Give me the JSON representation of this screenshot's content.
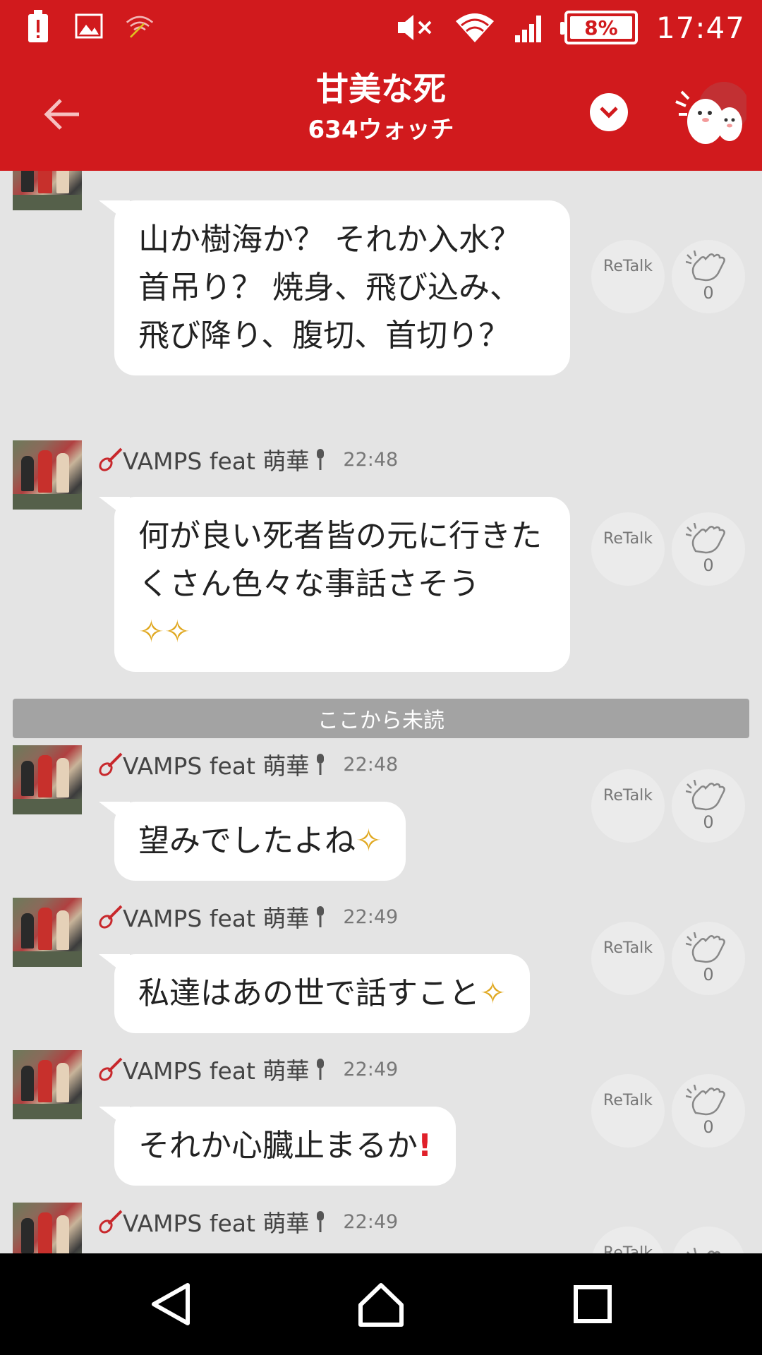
{
  "status_bar": {
    "battery_percent": "8%",
    "time": "17:47",
    "icons": [
      "alert-icon",
      "image-icon",
      "wifi-off-icon",
      "mute-icon",
      "wifi-icon",
      "signal-icon",
      "battery-icon"
    ]
  },
  "header": {
    "title": "甘美な死",
    "subtitle": "634ウォッチ",
    "color": "#d11a1d"
  },
  "messages": [
    {
      "sender": "",
      "time": "",
      "text": "山か樹海か？ それか入水？ 首吊り？ 焼身、飛び込み、飛び降り、腹切、首切り？",
      "retalk": "ReTalk",
      "claps": "0"
    },
    {
      "sender": "VAMPS feat 萌華",
      "time": "22:48",
      "text": "何が良い死者皆の元に行きたくさん色々な事話さそう",
      "retalk": "ReTalk",
      "claps": "0"
    },
    {
      "sender": "VAMPS feat 萌華",
      "time": "22:48",
      "text": "望みでしたよね",
      "retalk": "ReTalk",
      "claps": "0"
    },
    {
      "sender": "VAMPS feat 萌華",
      "time": "22:49",
      "text": "私達はあの世で話すこと",
      "retalk": "ReTalk",
      "claps": "0"
    },
    {
      "sender": "VAMPS feat 萌華",
      "time": "22:49",
      "text": "それか心臓止まるか",
      "retalk": "ReTalk",
      "claps": "0"
    },
    {
      "sender": "VAMPS feat 萌華",
      "time": "22:49",
      "text": "",
      "retalk": "ReTalk",
      "claps": ""
    }
  ],
  "unread_divider": "ここから未読",
  "nav": {
    "icons": [
      "back-triangle-icon",
      "home-icon",
      "recents-icon"
    ]
  }
}
